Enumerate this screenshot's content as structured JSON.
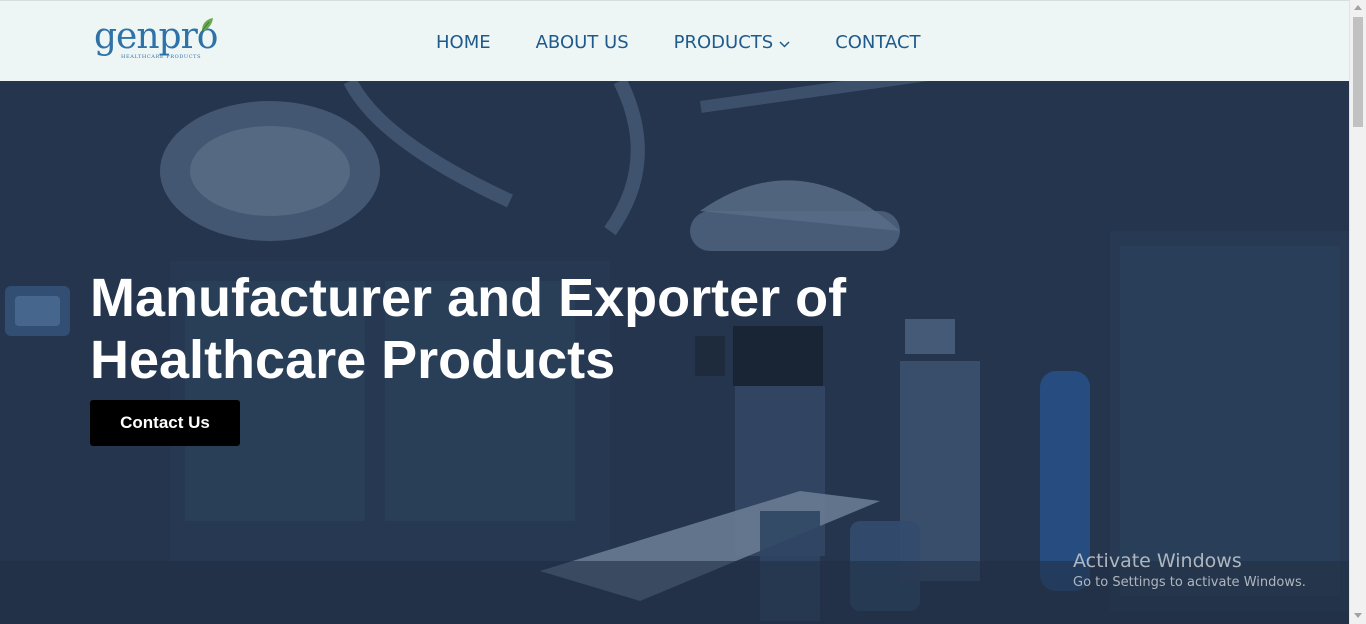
{
  "header": {
    "logo": {
      "wordmark": "genpro",
      "tagline": "HEALTHCARE PRODUCTS"
    },
    "nav": {
      "home": "HOME",
      "about": "ABOUT US",
      "products": "PRODUCTS",
      "contact": "CONTACT"
    }
  },
  "hero": {
    "title": "Manufacturer and Exporter of Healthcare Products",
    "cta": "Contact Us"
  },
  "watermark": {
    "title": "Activate Windows",
    "subtitle": "Go to Settings to activate Windows."
  },
  "colors": {
    "header_bg": "#eef6f5",
    "nav_text": "#1e5b8c",
    "hero_overlay": "#283b55",
    "cta_bg": "#000000"
  },
  "icons": {
    "logo_leaf": "leaf-icon",
    "products_dropdown": "chevron-down-icon"
  }
}
